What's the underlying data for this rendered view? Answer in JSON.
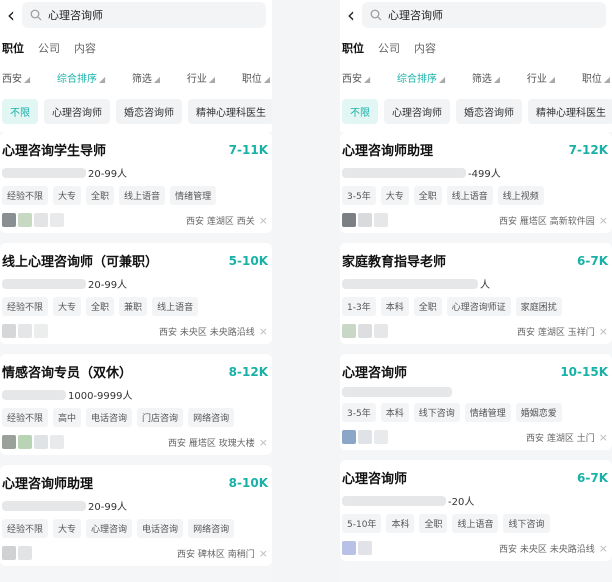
{
  "left": {
    "search": {
      "query": "心理咨询师"
    },
    "tabs": [
      "职位",
      "公司",
      "内容"
    ],
    "filters": [
      "西安",
      "综合排序",
      "筛选",
      "行业",
      "职位"
    ],
    "chips": [
      "不限",
      "心理咨询师",
      "婚恋咨询师",
      "精神心理科医生"
    ],
    "cards": [
      {
        "title": "心理咨询学生导师",
        "salary": "7-11K",
        "meta": "20-99人",
        "tags": [
          "经验不限",
          "大专",
          "全职",
          "线上语音",
          "情绪管理"
        ],
        "location": "西安 莲湖区 西关"
      },
      {
        "title": "线上心理咨询师（可兼职）",
        "salary": "5-10K",
        "meta": "20-99人",
        "tags": [
          "经验不限",
          "大专",
          "全职",
          "兼职",
          "线上语音"
        ],
        "location": "西安 未央区 未央路沿线"
      },
      {
        "title": "情感咨询专员（双休）",
        "salary": "8-12K",
        "meta": "1000-9999人",
        "tags": [
          "经验不限",
          "高中",
          "电话咨询",
          "门店咨询",
          "网络咨询"
        ],
        "location": "西安 雁塔区 玫瑰大楼"
      },
      {
        "title": "心理咨询师助理",
        "salary": "8-10K",
        "meta": "20-99人",
        "tags": [
          "经验不限",
          "大专",
          "心理咨询",
          "电话咨询",
          "网络咨询"
        ],
        "location": "西安 碑林区 南稍门"
      }
    ]
  },
  "right": {
    "search": {
      "query": "心理咨询师"
    },
    "tabs": [
      "职位",
      "公司",
      "内容"
    ],
    "filters": [
      "西安",
      "综合排序",
      "筛选",
      "行业",
      "职位"
    ],
    "chips": [
      "不限",
      "心理咨询师",
      "婚恋咨询师",
      "精神心理科医生"
    ],
    "cards": [
      {
        "title": "心理咨询师助理",
        "salary": "7-12K",
        "meta": "-499人",
        "tags": [
          "3-5年",
          "大专",
          "全职",
          "线上语音",
          "线上视频"
        ],
        "location": "西安 雁塔区 高新软件园"
      },
      {
        "title": "家庭教育指导老师",
        "salary": "6-7K",
        "meta": "人",
        "tags": [
          "1-3年",
          "本科",
          "全职",
          "心理咨询师证",
          "家庭困扰"
        ],
        "location": "西安 莲湖区 玉祥门"
      },
      {
        "title": "心理咨询师",
        "salary": "10-15K",
        "meta": "",
        "tags": [
          "3-5年",
          "本科",
          "线下咨询",
          "情绪管理",
          "婚姻恋爱"
        ],
        "location": "西安 莲湖区 土门"
      },
      {
        "title": "心理咨询师",
        "salary": "6-7K",
        "meta": "-20人",
        "tags": [
          "5-10年",
          "本科",
          "全职",
          "线上语音",
          "线下咨询"
        ],
        "location": "西安 未央区 未央路沿线"
      }
    ]
  },
  "colors": {
    "accent": "#17b1a7"
  }
}
